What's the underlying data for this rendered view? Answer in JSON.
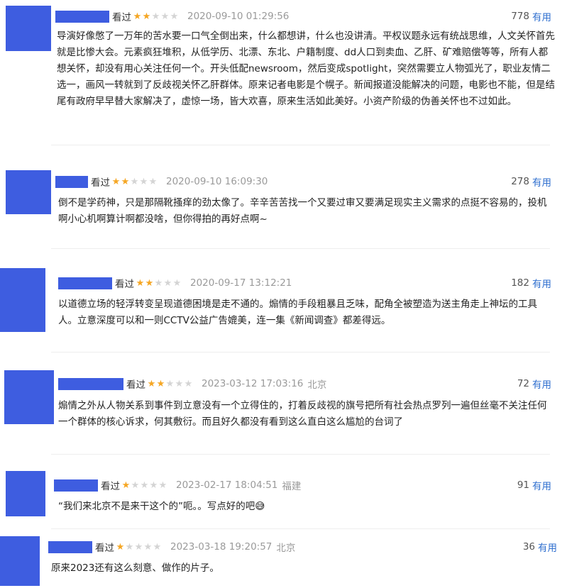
{
  "ui": {
    "watched_label": "看过",
    "useful_label": "有用"
  },
  "reviews": [
    {
      "stars": 2,
      "time": "2020-09-10 01:29:56",
      "location": "",
      "votes": "778",
      "text": "导演好像憋了一万年的苦水要一口气全倒出来，什么都想讲，什么也没讲清。平权议题永远有统战思维，人文关怀首先就是比惨大会。元素疯狂堆积，从低学历、北漂、东北、户籍制度、dd人口到卖血、乙肝、矿难赔偿等等，所有人都想关怀，却没有用心关注任何一个。开头低配newsroom，然后变成spotlight，突然需要立人物弧光了，职业友情二选一，画风一转就到了反歧视关怀乙肝群体。原来记者电影是个幌子。新闻报道没能解决的问题，电影也不能，但是结尾有政府早早替大家解决了，虚惊一场，皆大欢喜，原来生活如此美好。小资产阶级的伪善关怀也不过如此。"
    },
    {
      "stars": 2,
      "time": "2020-09-10 16:09:30",
      "location": "",
      "votes": "278",
      "text": "倒不是学药神，只是那隔靴搔痒的劲太像了。辛辛苦苦找一个又要过审又要满足现实主义需求的点挺不容易的，投机啊小心机啊算计啊都没啥，但你得拍的再好点啊~"
    },
    {
      "stars": 2,
      "time": "2020-09-17 13:12:21",
      "location": "",
      "votes": "182",
      "text": "以道德立场的轻浮转变呈现道德困境是走不通的。煽情的手段粗暴且乏味，配角全被塑造为送主角走上神坛的工具人。立意深度可以和一则CCTV公益广告媲美，连一集《新闻调查》都差得远。"
    },
    {
      "stars": 2,
      "time": "2023-03-12 17:03:16",
      "location": "北京",
      "votes": "72",
      "text": "煽情之外从人物关系到事件到立意没有一个立得住的，打着反歧视的旗号把所有社会热点罗列一遍但丝毫不关注任何一个群体的核心诉求，何其敷衍。而且好久都没有看到这么直白这么尴尬的台词了"
    },
    {
      "stars": 1,
      "time": "2023-02-17 18:04:51",
      "location": "福建",
      "votes": "91",
      "text": "“我们来北京不是来干这个的”呃。。写点好的吧😅"
    },
    {
      "stars": 1,
      "time": "2023-03-18 19:20:57",
      "location": "北京",
      "votes": "36",
      "text": "原来2023还有这么刻意、做作的片子。"
    }
  ]
}
